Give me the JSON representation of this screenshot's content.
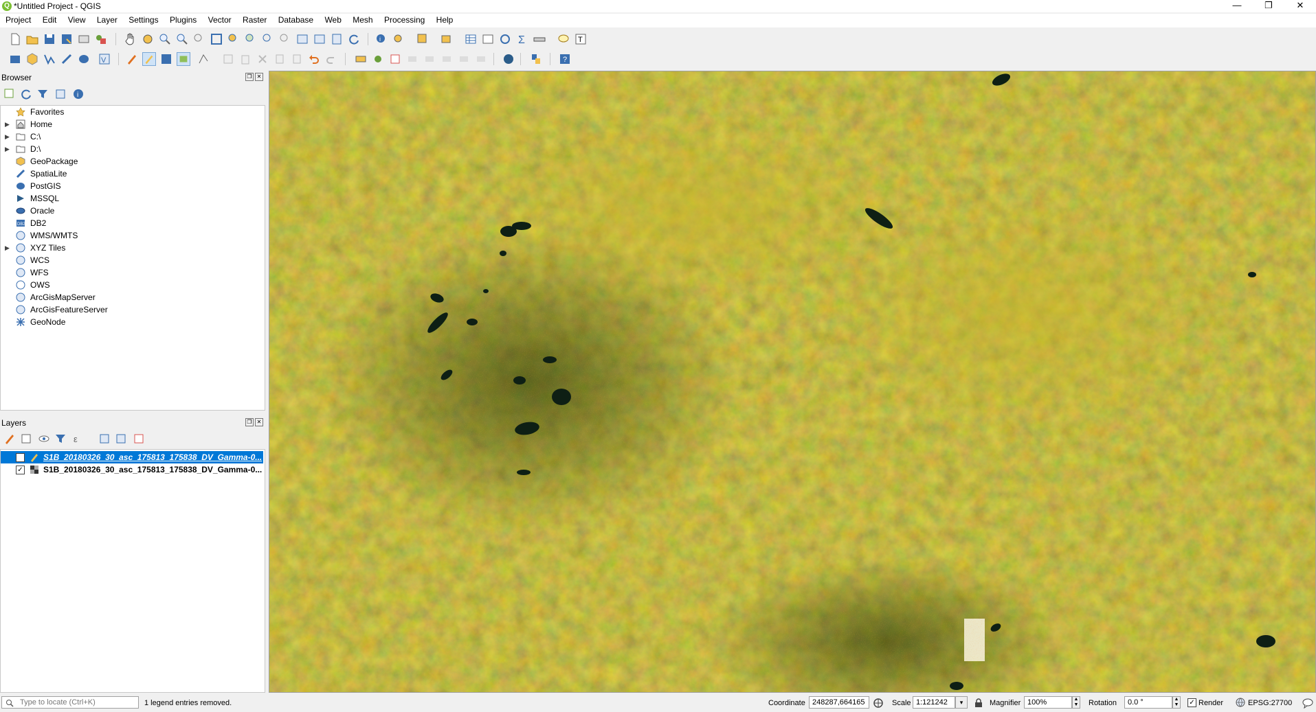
{
  "window": {
    "title": "*Untitled Project - QGIS",
    "minimize": "—",
    "maximize": "❐",
    "close": "✕"
  },
  "menu": [
    "Project",
    "Edit",
    "View",
    "Layer",
    "Settings",
    "Plugins",
    "Vector",
    "Raster",
    "Database",
    "Web",
    "Mesh",
    "Processing",
    "Help"
  ],
  "browser": {
    "title": "Browser",
    "items": [
      {
        "label": "Favorites",
        "icon": "star-icon",
        "expandable": false
      },
      {
        "label": "Home",
        "icon": "home-icon",
        "expandable": true
      },
      {
        "label": "C:\\",
        "icon": "folder-icon",
        "expandable": true
      },
      {
        "label": "D:\\",
        "icon": "folder-icon",
        "expandable": true
      },
      {
        "label": "GeoPackage",
        "icon": "geopackage-icon",
        "expandable": false
      },
      {
        "label": "SpatiaLite",
        "icon": "spatialite-icon",
        "expandable": false
      },
      {
        "label": "PostGIS",
        "icon": "postgis-icon",
        "expandable": false
      },
      {
        "label": "MSSQL",
        "icon": "mssql-icon",
        "expandable": false
      },
      {
        "label": "Oracle",
        "icon": "oracle-icon",
        "expandable": false
      },
      {
        "label": "DB2",
        "icon": "db2-icon",
        "expandable": false
      },
      {
        "label": "WMS/WMTS",
        "icon": "globe-icon",
        "expandable": false
      },
      {
        "label": "XYZ Tiles",
        "icon": "globe-icon",
        "expandable": true
      },
      {
        "label": "WCS",
        "icon": "globe-icon",
        "expandable": false
      },
      {
        "label": "WFS",
        "icon": "globe-icon",
        "expandable": false
      },
      {
        "label": "OWS",
        "icon": "globe-icon",
        "expandable": false
      },
      {
        "label": "ArcGisMapServer",
        "icon": "globe-icon",
        "expandable": false
      },
      {
        "label": "ArcGisFeatureServer",
        "icon": "globe-icon",
        "expandable": false
      },
      {
        "label": "GeoNode",
        "icon": "geonode-icon",
        "expandable": false
      }
    ]
  },
  "layers": {
    "title": "Layers",
    "items": [
      {
        "name": "S1B_20180326_30_asc_175813_175838_DV_Gamma-0...",
        "checked": false,
        "selected": true,
        "icon": "vector-edit-icon"
      },
      {
        "name": "S1B_20180326_30_asc_175813_175838_DV_Gamma-0...",
        "checked": true,
        "selected": false,
        "icon": "raster-layer-icon"
      }
    ]
  },
  "status": {
    "locate_placeholder": "Type to locate (Ctrl+K)",
    "message": "1 legend entries removed.",
    "coordinate_label": "Coordinate",
    "coordinate_value": "248287,664165",
    "scale_label": "Scale",
    "scale_value": "1:121242",
    "magnifier_label": "Magnifier",
    "magnifier_value": "100%",
    "rotation_label": "Rotation",
    "rotation_value": "0.0 °",
    "render_label": "Render",
    "render_checked": true,
    "crs": "EPSG:27700"
  },
  "colors": {
    "selection": "#0078d7",
    "map_base": "#9a8a1c"
  }
}
